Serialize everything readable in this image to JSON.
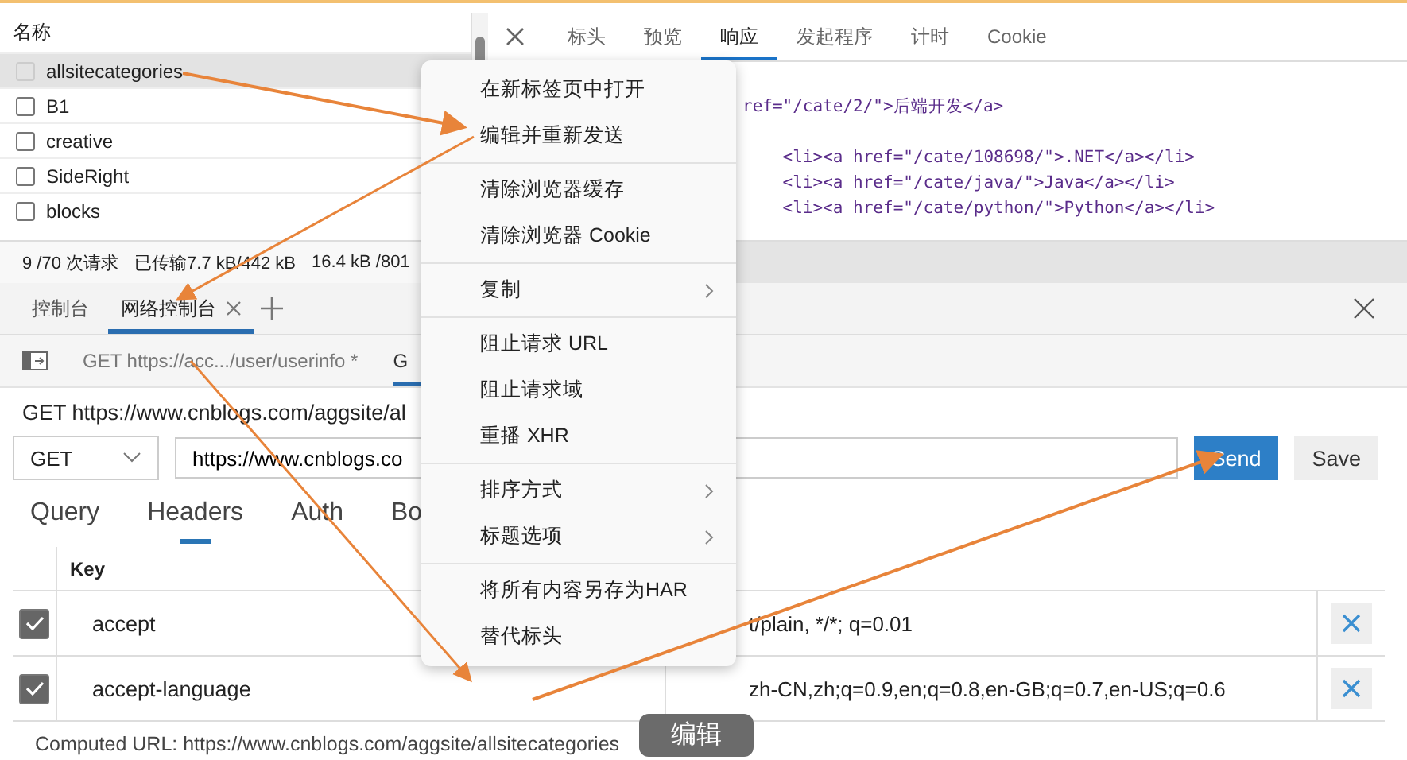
{
  "request_list": {
    "header": "名称",
    "items": [
      {
        "name": "allsitecategories",
        "selected": true
      },
      {
        "name": "B1",
        "selected": false
      },
      {
        "name": "creative",
        "selected": false
      },
      {
        "name": "SideRight",
        "selected": false
      },
      {
        "name": "blocks",
        "selected": false
      }
    ]
  },
  "detail_tabs": [
    {
      "label": "标头",
      "selected": false
    },
    {
      "label": "预览",
      "selected": false
    },
    {
      "label": "响应",
      "selected": true
    },
    {
      "label": "发起程序",
      "selected": false
    },
    {
      "label": "计时",
      "selected": false
    },
    {
      "label": "Cookie",
      "selected": false
    }
  ],
  "response_code": [
    "ref=\"/cate/2/\">后端开发</a>",
    "    <li><a href=\"/cate/108698/\">.NET</a></li>",
    "    <li><a href=\"/cate/java/\">Java</a></li>",
    "    <li><a href=\"/cate/python/\">Python</a></li>"
  ],
  "status_bar": [
    "9 /70 次请求",
    "已传输7.7 kB/442 kB",
    "16.4 kB /801"
  ],
  "drawer_tabs": [
    {
      "label": "控制台",
      "selected": false,
      "closable": false
    },
    {
      "label": "网络控制台",
      "selected": true,
      "closable": true
    }
  ],
  "request_tabs": [
    {
      "label": "GET https://acc.../user/userinfo *",
      "selected": false
    },
    {
      "label": "G",
      "selected": true
    }
  ],
  "request_title": "GET https://www.cnblogs.com/aggsite/al",
  "method": "GET",
  "url": "https://www.cnblogs.co",
  "buttons": [
    {
      "label": "Send",
      "kind": "primary"
    },
    {
      "label": "Save",
      "kind": "secondary"
    }
  ],
  "section_tabs": [
    {
      "label": "Query",
      "selected": false
    },
    {
      "label": "Headers",
      "selected": true
    },
    {
      "label": "Auth",
      "selected": false
    },
    {
      "label": "Bo",
      "selected": false
    }
  ],
  "headers_table": {
    "column": "Key",
    "rows": [
      {
        "checked": true,
        "key": "accept",
        "value": "t/plain, */*; q=0.01"
      },
      {
        "checked": true,
        "key": "accept-language",
        "value": "zh-CN,zh;q=0.9,en;q=0.8,en-GB;q=0.7,en-US;q=0.6"
      }
    ]
  },
  "computed_url": "Computed URL: https://www.cnblogs.com/aggsite/allsitecategories",
  "context_menu": [
    [
      {
        "label": "在新标签页中打开",
        "submenu": false
      },
      {
        "label": "编辑并重新发送",
        "submenu": false
      }
    ],
    [
      {
        "label": "清除浏览器缓存",
        "submenu": false
      },
      {
        "label": "清除浏览器 Cookie",
        "submenu": false
      }
    ],
    [
      {
        "label": "复制",
        "submenu": true
      }
    ],
    [
      {
        "label": "阻止请求 URL",
        "submenu": false
      },
      {
        "label": "阻止请求域",
        "submenu": false
      },
      {
        "label": "重播 XHR",
        "submenu": false
      }
    ],
    [
      {
        "label": "排序方式",
        "submenu": true
      },
      {
        "label": "标题选项",
        "submenu": true
      }
    ],
    [
      {
        "label": "将所有内容另存为HAR",
        "submenu": false
      },
      {
        "label": "替代标头",
        "submenu": false
      }
    ]
  ],
  "caption": "编辑"
}
